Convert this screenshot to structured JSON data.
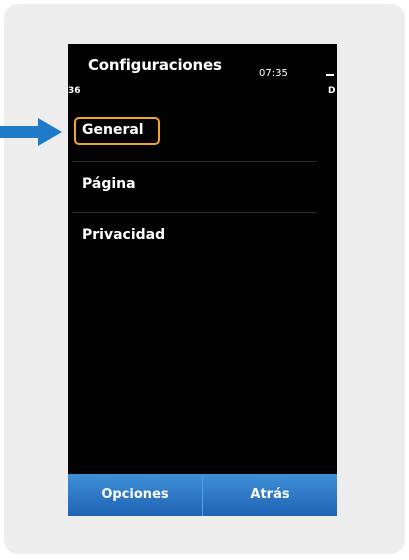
{
  "screen": {
    "title": "Configuraciones",
    "time": "07:35",
    "signal_text": "36",
    "battery_text": "D"
  },
  "menu": {
    "items": [
      {
        "label": "General"
      },
      {
        "label": "Página"
      },
      {
        "label": "Privacidad"
      }
    ]
  },
  "softkeys": {
    "left_label": "Opciones",
    "right_label": "Atrás"
  },
  "colors": {
    "highlight": "#f5a623",
    "pointer": "#1f7bc8",
    "softkey_bar": "#2f7bcf",
    "screen_background": "#020202"
  },
  "icons": {
    "pointer": "arrow-right-icon"
  }
}
